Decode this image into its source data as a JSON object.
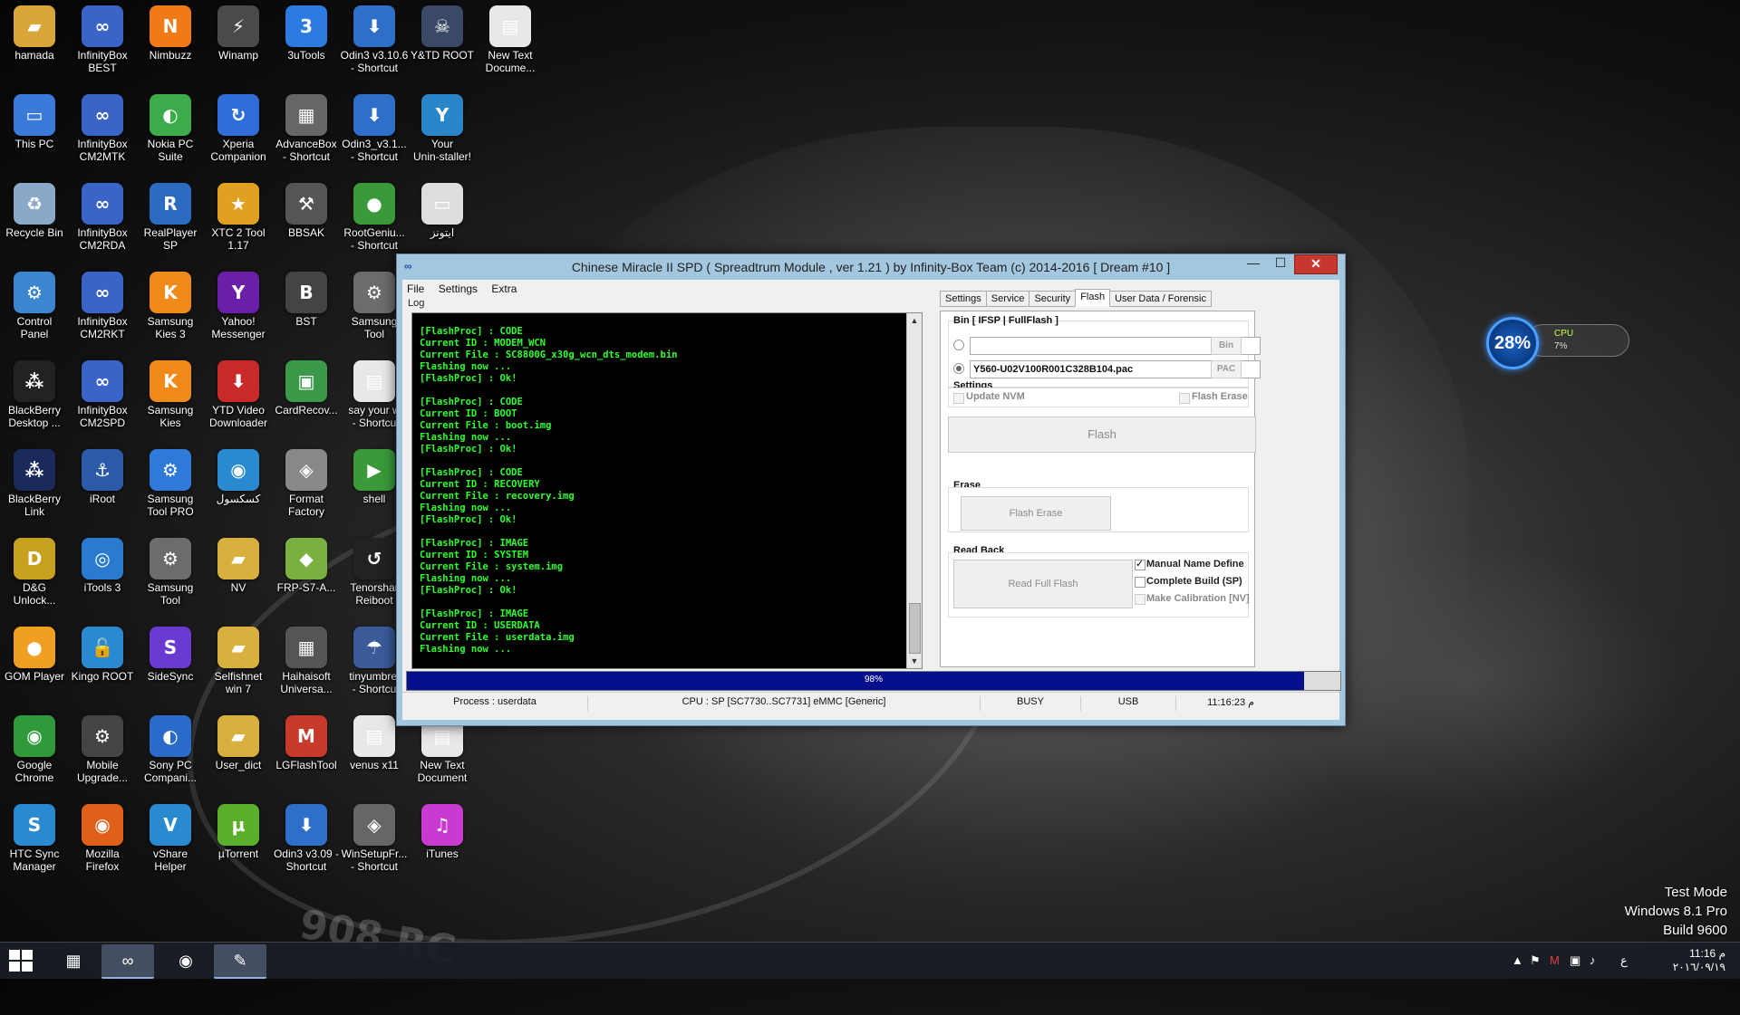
{
  "desktop": {
    "icons": [
      {
        "label": "hamada",
        "glyph": "▰",
        "color": "#d9a63a"
      },
      {
        "label": "InfinityBox\nBEST",
        "glyph": "∞",
        "color": "#3a64c8"
      },
      {
        "label": "Nimbuzz",
        "glyph": "N",
        "color": "#f07a16"
      },
      {
        "label": "Winamp",
        "glyph": "⚡",
        "color": "#4a4a4a"
      },
      {
        "label": "3uTools",
        "glyph": "3",
        "color": "#2c7be0"
      },
      {
        "label": "Odin3 v3.10.6\n- Shortcut",
        "glyph": "⬇",
        "color": "#2d6fc9"
      },
      {
        "label": "Y&TD ROOT",
        "glyph": "☠",
        "color": "#3a4a66"
      },
      {
        "label": "New Text\nDocume...",
        "glyph": "▤",
        "color": "#e8e8e8"
      },
      {
        "label": "This PC",
        "glyph": "▭",
        "color": "#3a7ad9"
      },
      {
        "label": "InfinityBox\nCM2MTK",
        "glyph": "∞",
        "color": "#3a64c8"
      },
      {
        "label": "Nokia PC\nSuite",
        "glyph": "◐",
        "color": "#3cab4a"
      },
      {
        "label": "Xperia\nCompanion",
        "glyph": "↻",
        "color": "#2f6ed8"
      },
      {
        "label": "AdvanceBox\n- Shortcut",
        "glyph": "▦",
        "color": "#666"
      },
      {
        "label": "Odin3_v3.1...\n- Shortcut",
        "glyph": "⬇",
        "color": "#2d6fc9"
      },
      {
        "label": "Your\nUnin-staller!",
        "glyph": "Y",
        "color": "#2a86c9"
      },
      {
        "label": "Recycle Bin",
        "glyph": "♻",
        "color": "#8aa8c8"
      },
      {
        "label": "InfinityBox\nCM2RDA",
        "glyph": "∞",
        "color": "#3a64c8"
      },
      {
        "label": "RealPlayer SP",
        "glyph": "R",
        "color": "#2b6bc0"
      },
      {
        "label": "XTC 2 Tool\n1.17",
        "glyph": "★",
        "color": "#e0a020"
      },
      {
        "label": "BBSAK",
        "glyph": "⚒",
        "color": "#555"
      },
      {
        "label": "RootGeniu...\n- Shortcut",
        "glyph": "●",
        "color": "#3a9a3a"
      },
      {
        "label": "ايتونز",
        "glyph": "▭",
        "color": "#ddd"
      },
      {
        "label": "Control\nPanel",
        "glyph": "⚙",
        "color": "#3c85cf"
      },
      {
        "label": "InfinityBox\nCM2RKT",
        "glyph": "∞",
        "color": "#3a64c8"
      },
      {
        "label": "Samsung\nKies 3",
        "glyph": "K",
        "color": "#f08a1a"
      },
      {
        "label": "Yahoo!\nMessenger",
        "glyph": "Y",
        "color": "#6a1fa8"
      },
      {
        "label": "BST",
        "glyph": "B",
        "color": "#444"
      },
      {
        "label": "Samsung\nTool",
        "glyph": "⚙",
        "color": "#6c6c6c"
      },
      {
        "label": "BlackBerry\nDesktop ...",
        "glyph": "⁂",
        "color": "#222"
      },
      {
        "label": "InfinityBox\nCM2SPD",
        "glyph": "∞",
        "color": "#3a64c8"
      },
      {
        "label": "Samsung\nKies",
        "glyph": "K",
        "color": "#f08a1a"
      },
      {
        "label": "YTD Video\nDownloader",
        "glyph": "⬇",
        "color": "#c82a2a"
      },
      {
        "label": "CardRecov...",
        "glyph": "▣",
        "color": "#3a9a4a"
      },
      {
        "label": "say your w\n- Shortcu",
        "glyph": "▤",
        "color": "#e8e8e8"
      },
      {
        "label": "BlackBerry\nLink",
        "glyph": "⁂",
        "color": "#1a2a5a"
      },
      {
        "label": "iRoot",
        "glyph": "⚓",
        "color": "#2a5aa8"
      },
      {
        "label": "Samsung\nTool PRO",
        "glyph": "⚙",
        "color": "#2f7ad9"
      },
      {
        "label": "كسكسول",
        "glyph": "◉",
        "color": "#2a8ad0"
      },
      {
        "label": "Format\nFactory",
        "glyph": "◈",
        "color": "#888"
      },
      {
        "label": "shell",
        "glyph": "▶",
        "color": "#3a9a3a"
      },
      {
        "label": "D&G\nUnlock...",
        "glyph": "D",
        "color": "#c8a020"
      },
      {
        "label": "iTools 3",
        "glyph": "◎",
        "color": "#2a7ad0"
      },
      {
        "label": "Samsung\nTool",
        "glyph": "⚙",
        "color": "#6c6c6c"
      },
      {
        "label": "NV",
        "glyph": "▰",
        "color": "#d9b040"
      },
      {
        "label": "FRP-S7-A...",
        "glyph": "◆",
        "color": "#7ab040"
      },
      {
        "label": "Tenorshar\nReiboot",
        "glyph": "↺",
        "color": "#222"
      },
      {
        "label": "GOM Player",
        "glyph": "●",
        "color": "#f0a020"
      },
      {
        "label": "Kingo ROOT",
        "glyph": "🔓",
        "color": "#2a8ad0"
      },
      {
        "label": "SideSync",
        "glyph": "S",
        "color": "#6a3ad0"
      },
      {
        "label": "Selfishnet\nwin 7",
        "glyph": "▰",
        "color": "#d9b040"
      },
      {
        "label": "Haihaisoft\nUniversa...",
        "glyph": "▦",
        "color": "#555"
      },
      {
        "label": "tinyumbrel\n- Shortcu",
        "glyph": "☂",
        "color": "#3a5a9a"
      },
      {
        "label": "Google\nChrome",
        "glyph": "◉",
        "color": "#2f9a3a"
      },
      {
        "label": "Mobile\nUpgrade...",
        "glyph": "⚙",
        "color": "#444"
      },
      {
        "label": "Sony PC\nCompani...",
        "glyph": "◐",
        "color": "#2a6ac8"
      },
      {
        "label": "User_dict",
        "glyph": "▰",
        "color": "#d9b040"
      },
      {
        "label": "LGFlashTool",
        "glyph": "M",
        "color": "#c83a2a"
      },
      {
        "label": "venus x11",
        "glyph": "▤",
        "color": "#e8e8e8"
      },
      {
        "label": "New Text\nDocument",
        "glyph": "▤",
        "color": "#e8e8e8"
      },
      {
        "label": "HTC Sync\nManager",
        "glyph": "S",
        "color": "#2a8ad0"
      },
      {
        "label": "Mozilla\nFirefox",
        "glyph": "◉",
        "color": "#e0601a"
      },
      {
        "label": "vShare\nHelper",
        "glyph": "V",
        "color": "#2a8ad0"
      },
      {
        "label": "µTorrent",
        "glyph": "µ",
        "color": "#5ab02a"
      },
      {
        "label": "Odin3 v3.09 -\nShortcut",
        "glyph": "⬇",
        "color": "#2d6fc9"
      },
      {
        "label": "WinSetupFr...\n- Shortcut",
        "glyph": "◈",
        "color": "#666"
      },
      {
        "label": "iTunes",
        "glyph": "♫",
        "color": "#c83ad0"
      }
    ],
    "watermark": [
      "Test Mode",
      "Windows 8.1 Pro",
      "Build 9600"
    ],
    "gadget": {
      "percent": "28%",
      "label": "CPU",
      "value": "7%"
    }
  },
  "window": {
    "title": "Chinese Miracle II SPD ( Spreadtrum Module , ver 1.21 ) by Infinity-Box Team (c) 2014-2016 [ Dream #10 ]",
    "controls": {
      "minimize": "—",
      "maximize": "☐",
      "close": "✕"
    },
    "menu": [
      "File",
      "Settings",
      "Extra"
    ],
    "log_label": "Log",
    "log": [
      [
        "[FlashProc] : CODE",
        "Current ID : MODEM_WCN",
        "Current File : SC8800G_x30g_wcn_dts_modem.bin",
        "Flashing now ...",
        "[FlashProc] : Ok!"
      ],
      [
        "[FlashProc] : CODE",
        "Current ID : BOOT",
        "Current File : boot.img",
        "Flashing now ...",
        "[FlashProc] : Ok!"
      ],
      [
        "[FlashProc] : CODE",
        "Current ID : RECOVERY",
        "Current File : recovery.img",
        "Flashing now ...",
        "[FlashProc] : Ok!"
      ],
      [
        "[FlashProc] : IMAGE",
        "Current ID : SYSTEM",
        "Current File : system.img",
        "Flashing now ...",
        "[FlashProc] : Ok!"
      ],
      [
        "[FlashProc] : IMAGE",
        "Current ID : USERDATA",
        "Current File : userdata.img",
        "Flashing now ..."
      ]
    ],
    "tabs": [
      {
        "label": "Settings",
        "active": false
      },
      {
        "label": "Service",
        "active": false
      },
      {
        "label": "Security",
        "active": false
      },
      {
        "label": "Flash",
        "active": true
      },
      {
        "label": "User Data / Forensic",
        "active": false
      }
    ],
    "flash_panel": {
      "bin_group_title": "Bin  [ IFSP | FullFlash ]",
      "bin_path": "",
      "bin_button": "Bin",
      "pac_path": "Y560-U02V100R001C328B104.pac",
      "pac_button": "PAC",
      "settings_title": "Settings",
      "update_nvm": "Update NVM",
      "flash_erase_check": "Flash Erase",
      "flash_button": "Flash",
      "erase_title": "Erase",
      "flash_erase_button": "Flash Erase",
      "readback_title": "Read Back",
      "read_full_flash_button": "Read Full Flash",
      "manual_name_define": "Manual Name Define",
      "complete_build": "Complete Build (SP)",
      "make_calibration": "Make Calibration [NV]"
    },
    "progress": {
      "value": 0.961,
      "text": "98%"
    },
    "status": {
      "process": "Process : userdata",
      "cpu": "CPU : SP [SC7730..SC7731] eMMC [Generic]",
      "state": "BUSY",
      "port": "USB",
      "time": "11:16:23 م"
    }
  },
  "taskbar": {
    "clock_time": "11:16 م",
    "clock_date": "٢٠١٦/٠٩/١٩",
    "lang": "ع"
  }
}
